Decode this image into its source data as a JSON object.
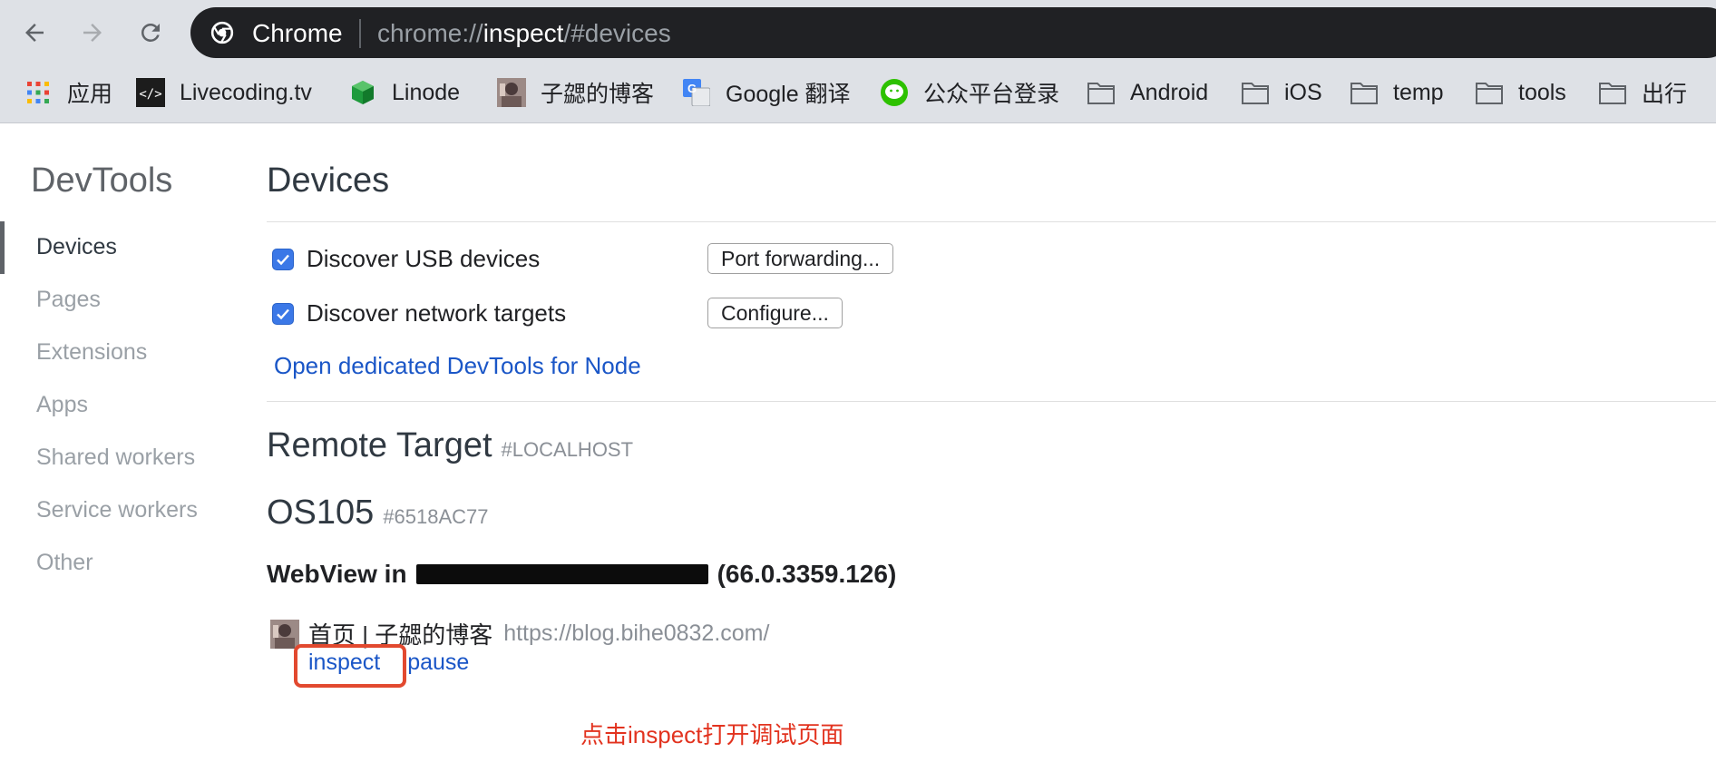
{
  "browser": {
    "omnibox": {
      "chip_label": "Chrome",
      "url_scheme": "chrome://",
      "url_host": "inspect",
      "url_path": "/#devices"
    },
    "bookmarks": [
      {
        "label": "应用",
        "icon": "apps-grid-icon"
      },
      {
        "label": "Livecoding.tv",
        "icon": "code-icon"
      },
      {
        "label": "Linode",
        "icon": "linode-cube-icon"
      },
      {
        "label": "子勰的博客",
        "icon": "avatar-icon"
      },
      {
        "label": "Google 翻译",
        "icon": "google-translate-icon"
      },
      {
        "label": "公众平台登录",
        "icon": "wechat-icon"
      },
      {
        "label": "Android",
        "icon": "folder-icon"
      },
      {
        "label": "iOS",
        "icon": "folder-icon"
      },
      {
        "label": "temp",
        "icon": "folder-icon"
      },
      {
        "label": "tools",
        "icon": "folder-icon"
      },
      {
        "label": "出行",
        "icon": "folder-icon"
      }
    ]
  },
  "sidebar": {
    "title": "DevTools",
    "items": [
      {
        "label": "Devices",
        "active": true
      },
      {
        "label": "Pages"
      },
      {
        "label": "Extensions"
      },
      {
        "label": "Apps"
      },
      {
        "label": "Shared workers"
      },
      {
        "label": "Service workers"
      },
      {
        "label": "Other"
      }
    ]
  },
  "main": {
    "title": "Devices",
    "usb": {
      "label": "Discover USB devices",
      "checked": true,
      "button": "Port forwarding..."
    },
    "network": {
      "label": "Discover network targets",
      "checked": true,
      "button": "Configure..."
    },
    "node_link": "Open dedicated DevTools for Node",
    "remote_target": {
      "title": "Remote Target",
      "tag": "#LOCALHOST"
    },
    "device": {
      "name": "OS105",
      "id": "#6518AC77"
    },
    "webview": {
      "prefix": "WebView in",
      "version": "(66.0.3359.126)"
    },
    "page": {
      "title": "首页 | 子勰的博客",
      "url": "https://blog.bihe0832.com/",
      "inspect": "inspect",
      "pause": "pause"
    }
  },
  "annotation": "点击inspect打开调试页面",
  "colors": {
    "link": "#1a56c7",
    "checkbox": "#3b78e7",
    "highlight": "#e2492f",
    "annotation": "#e2331f"
  }
}
